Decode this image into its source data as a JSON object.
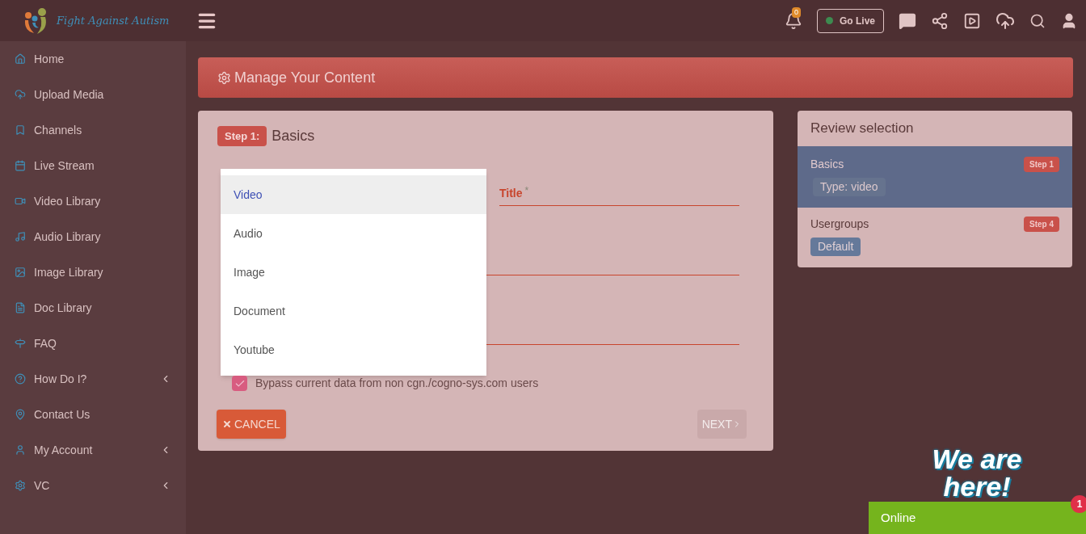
{
  "brand": {
    "name": "Fight Against Autism"
  },
  "topbar": {
    "notifications": "0",
    "go_live": {
      "label": "Go Live",
      "on": true
    }
  },
  "sidebar": {
    "items": [
      {
        "label": "Home",
        "kind": "home",
        "expandable": false
      },
      {
        "label": "Upload Media",
        "kind": "upload",
        "expandable": false
      },
      {
        "label": "Channels",
        "kind": "bookmark",
        "expandable": false
      },
      {
        "label": "Live Stream",
        "kind": "calendar",
        "expandable": false
      },
      {
        "label": "Video Library",
        "kind": "video",
        "expandable": false
      },
      {
        "label": "Audio Library",
        "kind": "music",
        "expandable": false
      },
      {
        "label": "Image Library",
        "kind": "image",
        "expandable": false
      },
      {
        "label": "Doc Library",
        "kind": "file",
        "expandable": false
      },
      {
        "label": "FAQ",
        "kind": "signpost",
        "expandable": false
      },
      {
        "label": "How Do I?",
        "kind": "help",
        "expandable": true
      },
      {
        "label": "Contact Us",
        "kind": "pin",
        "expandable": false
      },
      {
        "label": "My Account",
        "kind": "user",
        "expandable": true
      },
      {
        "label": "VC",
        "kind": "cogs",
        "expandable": true
      }
    ]
  },
  "page_header": {
    "title": "Manage Your Content"
  },
  "form": {
    "step_badge": "Step 1:",
    "step_title": "Basics",
    "dropdown": [
      {
        "label": "Video",
        "selected": true
      },
      {
        "label": "Audio",
        "selected": false
      },
      {
        "label": "Image",
        "selected": false
      },
      {
        "label": "Document",
        "selected": false
      },
      {
        "label": "Youtube",
        "selected": false
      }
    ],
    "title_field": {
      "label": "Title",
      "required_mark": "*"
    },
    "checkbox": {
      "label": "Bypass current data from non cgn./cogno-sys.com users",
      "checked": true
    },
    "cancel": "CANCEL",
    "next": {
      "label": "NEXT",
      "disabled": true
    }
  },
  "review": {
    "title": "Review selection",
    "sections": [
      {
        "name": "Basics",
        "step": "Step 1",
        "tag": "Type: video",
        "selected": true
      },
      {
        "name": "Usergroups",
        "step": "Step 4",
        "tag": "Default",
        "selected": false
      }
    ]
  },
  "chat": {
    "slogan": "We are here!",
    "status": "Online",
    "unread": "1"
  }
}
